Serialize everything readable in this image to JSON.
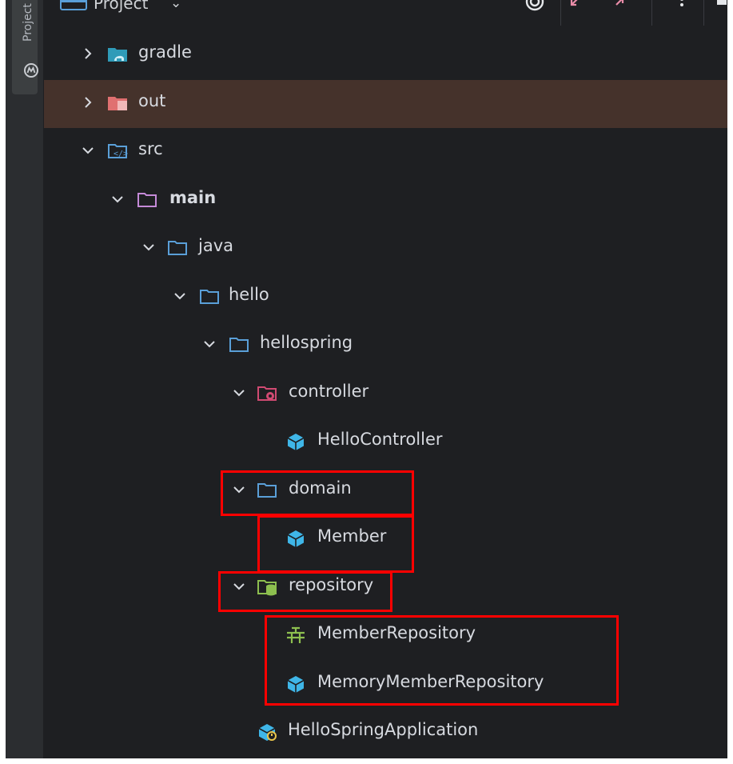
{
  "sidebar": {
    "project_tab_label": "Project"
  },
  "header": {
    "title": "Project"
  },
  "tree": [
    {
      "id": "gradle",
      "label": "gradle",
      "expanded": false,
      "icon": "gradle-folder-icon"
    },
    {
      "id": "out",
      "label": "out",
      "expanded": false,
      "icon": "excluded-folder-icon",
      "selected": true
    },
    {
      "id": "src",
      "label": "src",
      "expanded": true,
      "icon": "source-folder-icon"
    },
    {
      "id": "main",
      "label": "main",
      "expanded": true,
      "icon": "module-folder-icon"
    },
    {
      "id": "java",
      "label": "java",
      "expanded": true,
      "icon": "folder-icon"
    },
    {
      "id": "hello",
      "label": "hello",
      "expanded": true,
      "icon": "folder-icon"
    },
    {
      "id": "hellospring",
      "label": "hellospring",
      "expanded": true,
      "icon": "folder-icon"
    },
    {
      "id": "controller",
      "label": "controller",
      "expanded": true,
      "icon": "controller-package-icon"
    },
    {
      "id": "HelloController",
      "label": "HelloController",
      "icon": "class-icon"
    },
    {
      "id": "domain",
      "label": "domain",
      "expanded": true,
      "icon": "folder-icon"
    },
    {
      "id": "Member",
      "label": "Member",
      "icon": "class-icon"
    },
    {
      "id": "repository",
      "label": "repository",
      "expanded": true,
      "icon": "repository-package-icon"
    },
    {
      "id": "MemberRepository",
      "label": "MemberRepository",
      "icon": "interface-icon"
    },
    {
      "id": "MemoryMemberRepository",
      "label": "MemoryMemberRepository",
      "icon": "class-icon"
    },
    {
      "id": "HelloSpringApplication",
      "label": "HelloSpringApplication",
      "icon": "spring-boot-app-icon"
    }
  ],
  "colors": {
    "panel_bg": "#1e1f22",
    "selection_bg": "#45322b",
    "text": "#d7dae0",
    "highlight_box": "#ff0000",
    "class_icon": "#3fb6e8"
  }
}
